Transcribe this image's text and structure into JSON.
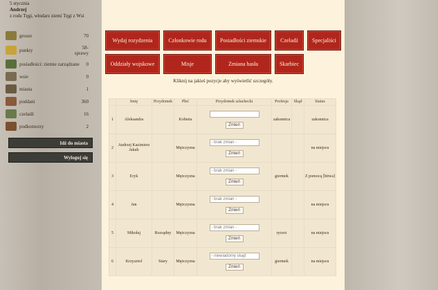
{
  "header": {
    "line1": "5 stycznia",
    "line2": "Andrzej",
    "line3": "z rodu Tęgi, włodarz ziemi Tęgi z Wsi"
  },
  "resources": [
    {
      "label": "grosze",
      "value": "70",
      "color": "#8a7a3c"
    },
    {
      "label": "punkty",
      "value": "58-\nsprawy",
      "color": "#c8a33a"
    },
    {
      "label": "posiadłości: ziemie zarządzane",
      "value": "0",
      "color": "#5a6e3a"
    },
    {
      "label": "wsie",
      "value": "0",
      "color": "#7a6a50"
    },
    {
      "label": "miasta",
      "value": "1",
      "color": "#6b5a42"
    },
    {
      "label": "poddani",
      "value": "360",
      "color": "#8a5a3a"
    },
    {
      "label": "czeladź",
      "value": "16",
      "color": "#6a7a4a"
    },
    {
      "label": "podkomorzy",
      "value": "2",
      "color": "#7a5030"
    }
  ],
  "sidebar_buttons": {
    "city": "Idź do miasta",
    "logout": "Wyloguj się"
  },
  "main_buttons": [
    "Wydaj rozydzenia",
    "Członkowie rodu",
    "Posiadłości ziemskie",
    "Czeladź",
    "Specjaliści",
    "Oddziały wojskowe",
    "Misje",
    "Zmiana hasła",
    "Skarbiec"
  ],
  "instruction": "Kliknij na jakieś pozycje aby wyświetlić szczegóły.",
  "table": {
    "headers": [
      "",
      "Imię",
      "Przydomek",
      "Płeć",
      "Przydomek szlachecki",
      "Profesja",
      "Skąd",
      "Status"
    ],
    "select_default": "- brak zmiany -",
    "button": "Zmień",
    "rows": [
      {
        "n": "1",
        "name": "Aleksandra",
        "nick": "",
        "sex": "Kobieta",
        "select": "",
        "prof": "zakonnica",
        "from": "",
        "status": "zakonnica"
      },
      {
        "n": "2",
        "name": "Andrzej Kazimierz Jakub",
        "nick": "",
        "sex": "Mężczyzna",
        "select": "- brak zmian -",
        "prof": "",
        "from": "",
        "status": "na miejscu"
      },
      {
        "n": "3",
        "name": "Eryk",
        "nick": "",
        "sex": "Mężczyzna",
        "select": "- brak zmian -",
        "prof": "giermek",
        "from": "",
        "status": "Z pomocą [bitwa]"
      },
      {
        "n": "4",
        "name": "Jan",
        "nick": "",
        "sex": "Mężczyzna",
        "select": "- brak zmian -",
        "prof": "",
        "from": "",
        "status": "na miejscu"
      },
      {
        "n": "5",
        "name": "Mikołaj",
        "nick": "Rozsądny",
        "sex": "Mężczyzna",
        "select": "- brak zmian -",
        "prof": "rycerz",
        "from": "",
        "status": "na miejscu"
      },
      {
        "n": "6",
        "name": "Krzysztof",
        "nick": "Stary",
        "sex": "Mężczyzna",
        "select": "- niewiadomy skąd",
        "prof": "giermek",
        "from": "",
        "status": "na miejscu"
      }
    ]
  }
}
